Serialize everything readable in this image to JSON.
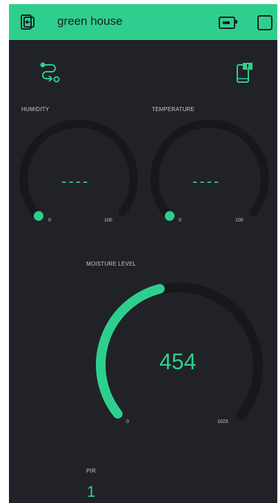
{
  "header": {
    "title": "green house"
  },
  "colors": {
    "accent": "#2ecf8e",
    "background": "#212227",
    "track": "#17181c"
  },
  "icons": {
    "back": "exit-icon",
    "connection": "device-online-icon",
    "stop": "stop-icon",
    "routes": "eventor-icon",
    "device": "device-notification-icon"
  },
  "gauges": {
    "humidity": {
      "label": "HUMIDITY",
      "value": "----",
      "min": "0",
      "max": "100"
    },
    "temperature": {
      "label": "TEMPERATURE",
      "value": "----",
      "min": "0",
      "max": "100"
    },
    "moisture": {
      "label": "MOISTURE LEVEL",
      "value": "454",
      "min": "0",
      "max": "1023",
      "fill_fraction": 0.444
    }
  },
  "pir": {
    "label": "PIR",
    "value": "1"
  }
}
